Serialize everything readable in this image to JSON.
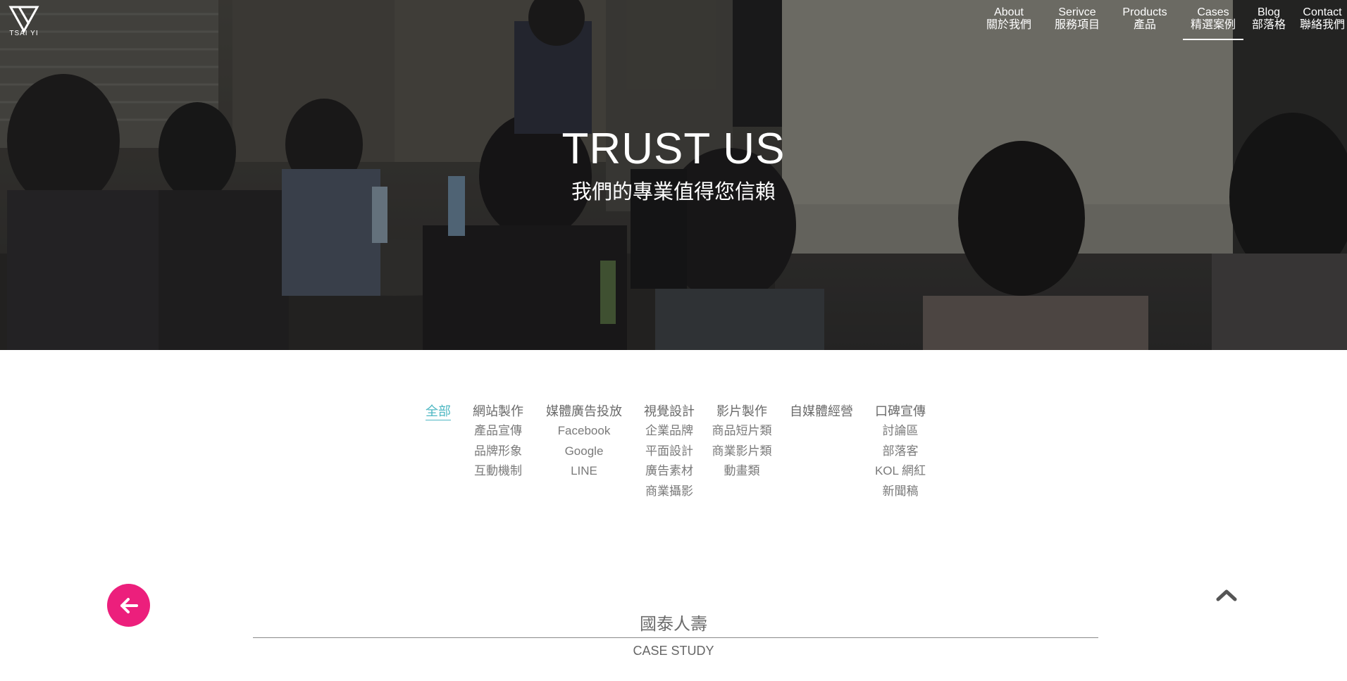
{
  "brand": {
    "logo_text": "TSAI YI"
  },
  "nav": [
    {
      "en": "About",
      "zh": "關於我們",
      "active": false
    },
    {
      "en": "Serivce",
      "zh": "服務項目",
      "active": false
    },
    {
      "en": "Products",
      "zh": "產品",
      "active": false
    },
    {
      "en": "Cases",
      "zh": "精選案例",
      "active": true
    },
    {
      "en": "Blog",
      "zh": "部落格",
      "active": false
    },
    {
      "en": "Contact",
      "zh": "聯絡我們",
      "active": false
    }
  ],
  "hero": {
    "title": "TRUST US",
    "subtitle": "我們的專業值得您信賴"
  },
  "filters": [
    {
      "label": "全部",
      "active": true,
      "items": []
    },
    {
      "label": "網站製作",
      "active": false,
      "items": [
        "產品宣傳",
        "品牌形象",
        "互動機制"
      ]
    },
    {
      "label": "媒體廣告投放",
      "active": false,
      "items": [
        "Facebook",
        "Google",
        "LINE"
      ]
    },
    {
      "label": "視覺設計",
      "active": false,
      "items": [
        "企業品牌",
        "平面設計",
        "廣告素材",
        "商業攝影"
      ]
    },
    {
      "label": "影片製作",
      "active": false,
      "items": [
        "商品短片類",
        "商業影片類",
        "動畫類"
      ]
    },
    {
      "label": "自媒體經營",
      "active": false,
      "items": []
    },
    {
      "label": "口碑宣傳",
      "active": false,
      "items": [
        "討論區",
        "部落客",
        "KOL 網紅",
        "新聞稿"
      ]
    }
  ],
  "case": {
    "title": "國泰人壽",
    "label": "CASE STUDY"
  },
  "icons": {
    "back": "arrow-left-icon",
    "top": "chevron-up-icon"
  },
  "colors": {
    "accent_pink": "#ec1f7c",
    "active_filter": "#4fb8c3"
  }
}
